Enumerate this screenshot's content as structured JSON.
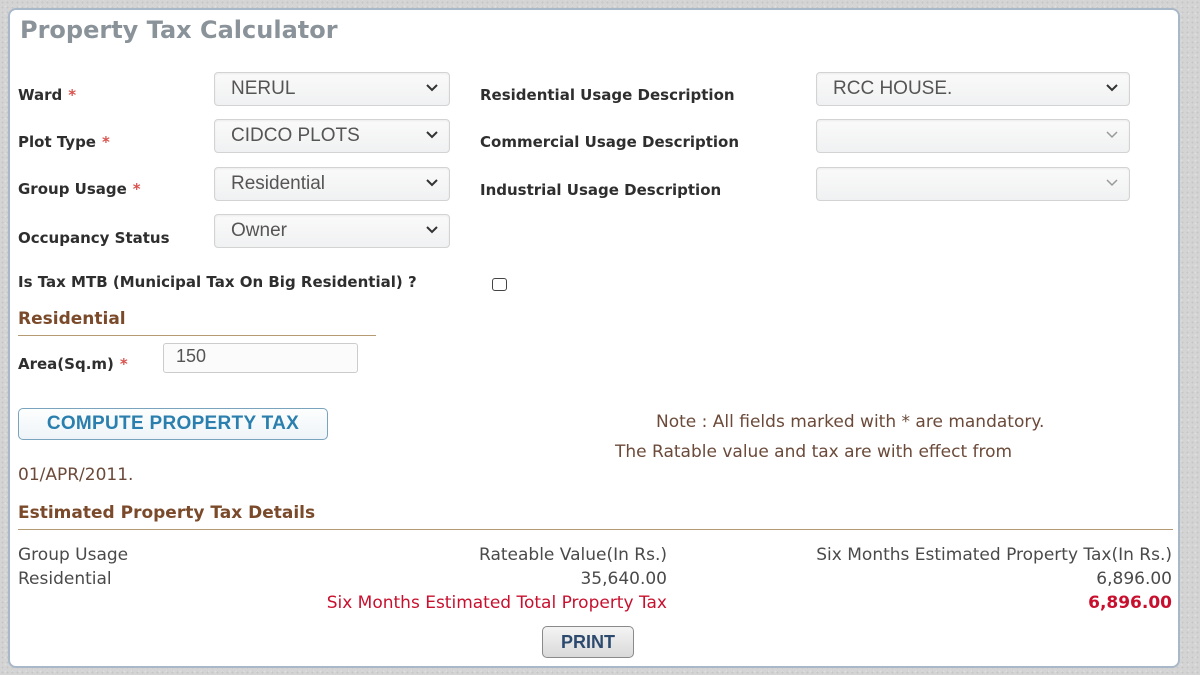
{
  "page": {
    "title": "Property Tax Calculator"
  },
  "form": {
    "ward": {
      "label": "Ward",
      "required_mark": "*",
      "value": "NERUL"
    },
    "plot_type": {
      "label": "Plot Type",
      "required_mark": "*",
      "value": "CIDCO PLOTS"
    },
    "group_usage": {
      "label": "Group Usage",
      "required_mark": "*",
      "value": "Residential"
    },
    "occupancy_status": {
      "label": "Occupancy Status",
      "value": "Owner"
    },
    "residential_usage": {
      "label": "Residential Usage Description",
      "value": "RCC HOUSE."
    },
    "commercial_usage": {
      "label": "Commercial Usage Description",
      "value": ""
    },
    "industrial_usage": {
      "label": "Industrial Usage Description",
      "value": ""
    },
    "mtb": {
      "label": "Is Tax MTB (Municipal Tax On Big Residential) ?",
      "checked": false
    }
  },
  "residential_section": {
    "heading": "Residential",
    "area_label": "Area(Sq.m)",
    "area_required_mark": "*",
    "area_value": "150"
  },
  "actions": {
    "compute_label": "COMPUTE PROPERTY TAX",
    "print_label": "PRINT"
  },
  "notes": {
    "mandatory": "Note : All fields marked with * are mandatory.",
    "effective_line1": "The Ratable value and tax are with effect from",
    "effective_line2": "01/APR/2011."
  },
  "estimate": {
    "heading": "Estimated Property Tax Details",
    "columns": [
      "Group Usage",
      "Rateable Value(In Rs.)",
      "Six Months Estimated Property Tax(In Rs.)"
    ],
    "rows": [
      {
        "group_usage": "Residential",
        "rateable_value": "35,640.00",
        "six_month_tax": "6,896.00"
      }
    ],
    "total_label": "Six Months Estimated Total Property Tax",
    "total_value": "6,896.00"
  },
  "colors": {
    "required": "#d9534f",
    "section_heading": "#7a4a2a",
    "total_red": "#c8102e",
    "compute_button_text": "#2a7fae"
  }
}
